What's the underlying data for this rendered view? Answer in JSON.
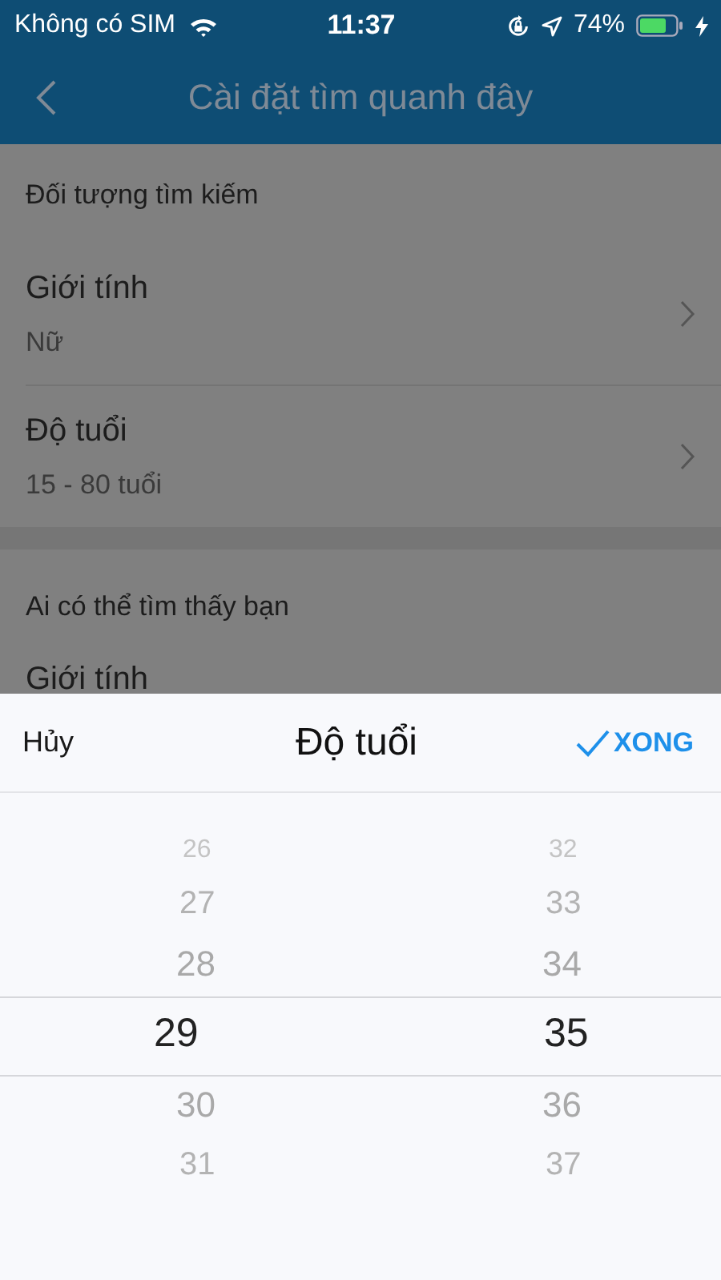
{
  "status_bar": {
    "carrier": "Không có SIM",
    "time": "11:37",
    "battery": "74%"
  },
  "nav": {
    "title": "Cài đặt tìm quanh đây"
  },
  "sections": [
    {
      "header": "Đối tượng tìm kiếm",
      "rows": [
        {
          "label": "Giới tính",
          "value": "Nữ"
        },
        {
          "label": "Độ tuổi",
          "value": "15 - 80 tuổi"
        }
      ]
    },
    {
      "header": "Ai có thể tìm thấy bạn",
      "rows": [
        {
          "label": "Giới tính"
        }
      ]
    }
  ],
  "sheet": {
    "cancel": "Hủy",
    "title": "Độ tuổi",
    "done": "XONG",
    "columns": [
      {
        "items": [
          {
            "label": "26",
            "selected": false
          },
          {
            "label": "27",
            "selected": false
          },
          {
            "label": "28",
            "selected": false
          },
          {
            "label": "29",
            "selected": true
          },
          {
            "label": "30",
            "selected": false
          },
          {
            "label": "31",
            "selected": false
          }
        ]
      },
      {
        "items": [
          {
            "label": "32",
            "selected": false
          },
          {
            "label": "33",
            "selected": false
          },
          {
            "label": "34",
            "selected": false
          },
          {
            "label": "35",
            "selected": true
          },
          {
            "label": "36",
            "selected": false
          },
          {
            "label": "37",
            "selected": false
          }
        ]
      }
    ]
  }
}
